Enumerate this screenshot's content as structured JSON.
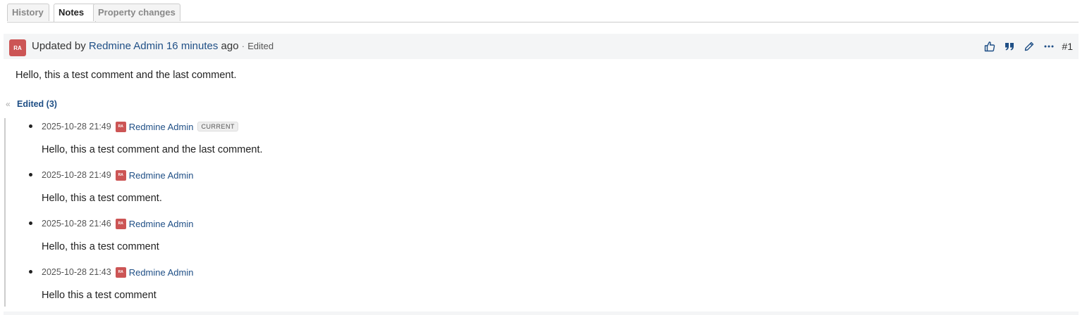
{
  "tabs": [
    {
      "label": "History",
      "selected": false
    },
    {
      "label": "Notes",
      "selected": true
    },
    {
      "label": "Property changes",
      "selected": false
    }
  ],
  "journal": {
    "avatar_initials": "RA",
    "avatar_color": "#cc5555",
    "prefix": "Updated by",
    "author": "Redmine Admin",
    "time_ago": "16 minutes",
    "suffix": "ago",
    "separator": "·",
    "edited_label": "Edited",
    "number": "#1",
    "actions": [
      "thumbs-up-icon",
      "quote-icon",
      "edit-icon",
      "more-icon"
    ],
    "note": "Hello, this a test comment and the last comment."
  },
  "edited_toggle": {
    "label": "Edited (3)"
  },
  "revisions": [
    {
      "date": "2025-10-28 21:49",
      "avatar": "RA",
      "user": "Redmine Admin",
      "badge": "CURRENT",
      "text": "Hello, this a test comment and the last comment."
    },
    {
      "date": "2025-10-28 21:49",
      "avatar": "RA",
      "user": "Redmine Admin",
      "badge": "",
      "text": "Hello, this a test comment."
    },
    {
      "date": "2025-10-28 21:46",
      "avatar": "RA",
      "user": "Redmine Admin",
      "badge": "",
      "text": "Hello, this a test comment"
    },
    {
      "date": "2025-10-28 21:43",
      "avatar": "RA",
      "user": "Redmine Admin",
      "badge": "",
      "text": "Hello this a test comment"
    }
  ]
}
